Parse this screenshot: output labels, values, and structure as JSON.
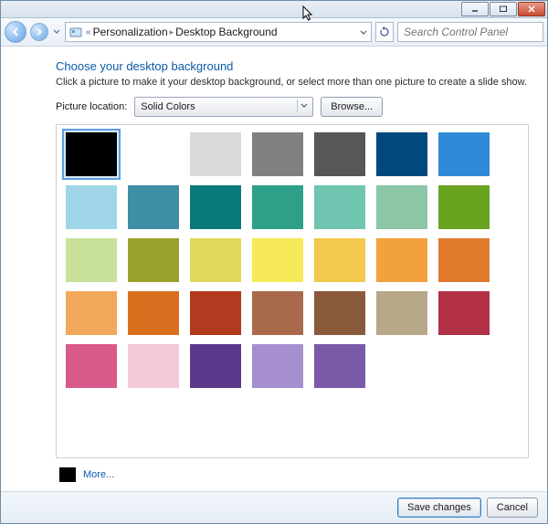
{
  "breadcrumbs": {
    "level1": "Personalization",
    "level2": "Desktop Background"
  },
  "search": {
    "placeholder": "Search Control Panel"
  },
  "page": {
    "title": "Choose your desktop background",
    "subtitle": "Click a picture to make it your desktop background, or select more than one picture to create a slide show."
  },
  "picture_location": {
    "label": "Picture location:",
    "selected": "Solid Colors",
    "browse_label": "Browse..."
  },
  "swatches": {
    "selected_index": 0,
    "colors": [
      "#000000",
      "#ffffff",
      "#d9d9d9",
      "#808080",
      "#575757",
      "#004a7f",
      "#2f8bd8",
      "#9ed6e8",
      "#3e8fa3",
      "#087a7a",
      "#2ea08a",
      "#6fc5b0",
      "#8bc6a6",
      "#6aa31f",
      "#c9e09a",
      "#9aa22e",
      "#e0d85a",
      "#f6ea5a",
      "#f2c94c",
      "#f2a23c",
      "#e07b2e",
      "#f2a85a",
      "#d96f1e",
      "#b23a1e",
      "#a86a4a",
      "#8a5a3a",
      "#b8a88a",
      "#b23046",
      "#d85a8a",
      "#f4c9d7",
      "#5a3a8a",
      "#a68fcf",
      "#7a5aa8"
    ]
  },
  "more": {
    "swatch": "#000000",
    "label": "More..."
  },
  "footer": {
    "save": "Save changes",
    "cancel": "Cancel"
  },
  "icons": {
    "back": "back-arrow",
    "forward": "forward-arrow",
    "dropdown": "chevron-down",
    "refresh": "refresh",
    "search": "magnifier",
    "folder": "control-panel"
  }
}
